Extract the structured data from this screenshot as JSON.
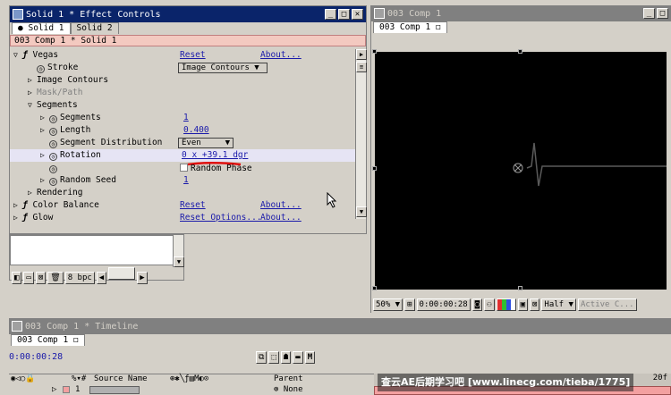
{
  "effect_controls": {
    "title": "Solid 1 * Effect Controls",
    "tabs": [
      {
        "label": "Solid 1"
      },
      {
        "label": "Solid 2"
      }
    ],
    "layer_header": "003 Comp 1 * Solid 1",
    "rows": [
      {
        "label": "Vegas",
        "reset": "Reset",
        "about": "About..."
      },
      {
        "label": "Stroke",
        "value": "Image Contours"
      },
      {
        "label": "Image Contours"
      },
      {
        "label": "Mask/Path"
      },
      {
        "label": "Segments"
      },
      {
        "label": "Segments",
        "value": "1"
      },
      {
        "label": "Length",
        "value": "0.400"
      },
      {
        "label": "Segment Distribution",
        "value": "Even"
      },
      {
        "label": "Rotation",
        "value": "0 x +39.1 dgr"
      },
      {
        "label": "Random Phase"
      },
      {
        "label": "Random Seed",
        "value": "1"
      },
      {
        "label": "Rendering"
      },
      {
        "label": "Color Balance",
        "reset": "Reset",
        "about": "About..."
      },
      {
        "label": "Glow",
        "reset": "Reset Options...",
        "about": "About..."
      }
    ],
    "project_bpc": "8 bpc"
  },
  "comp_viewer": {
    "title": "003 Comp 1",
    "tab": "003 Comp 1",
    "zoom": "50%",
    "timecode": "0:00:00:28",
    "resolution": "Half",
    "camera": "Active C..."
  },
  "timeline": {
    "title": "003 Comp 1 * Timeline",
    "tab": "003 Comp 1",
    "timecode": "0:00:00:28",
    "col_source_name": "Source Name",
    "col_parent": "Parent",
    "row_index": "1",
    "row_parent": "None",
    "ruler_end": "20f"
  },
  "watermark": "查云AE后期学习吧 [www.linecg.com/tieba/1775]",
  "colors": {
    "title_active": "#0a246a",
    "panel": "#d4d0c8",
    "layer_header": "#f3c9c0",
    "link": "#1a1aaa",
    "annotation": "#e01010"
  }
}
